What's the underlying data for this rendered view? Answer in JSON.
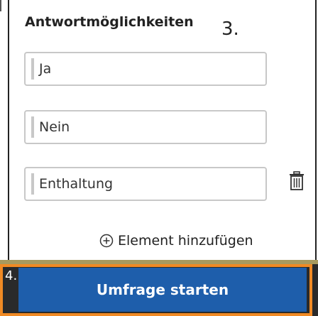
{
  "header": {
    "title": "Antwortmöglichkeiten",
    "step_number": "3."
  },
  "options": [
    {
      "value": "Ja"
    },
    {
      "value": "Nein"
    },
    {
      "value": "Enthaltung"
    }
  ],
  "icons": {
    "delete": "trash-icon",
    "add": "plus-circle-icon"
  },
  "add_element": {
    "label": "Element hinzufügen"
  },
  "footer": {
    "focus_number": "4.",
    "start_button_label": "Umfrage starten"
  },
  "colors": {
    "primary": "#1e5eab",
    "focus_outline": "#f08a24",
    "field_border": "#c8c8c8",
    "olive_strip": "#a89a5e"
  }
}
